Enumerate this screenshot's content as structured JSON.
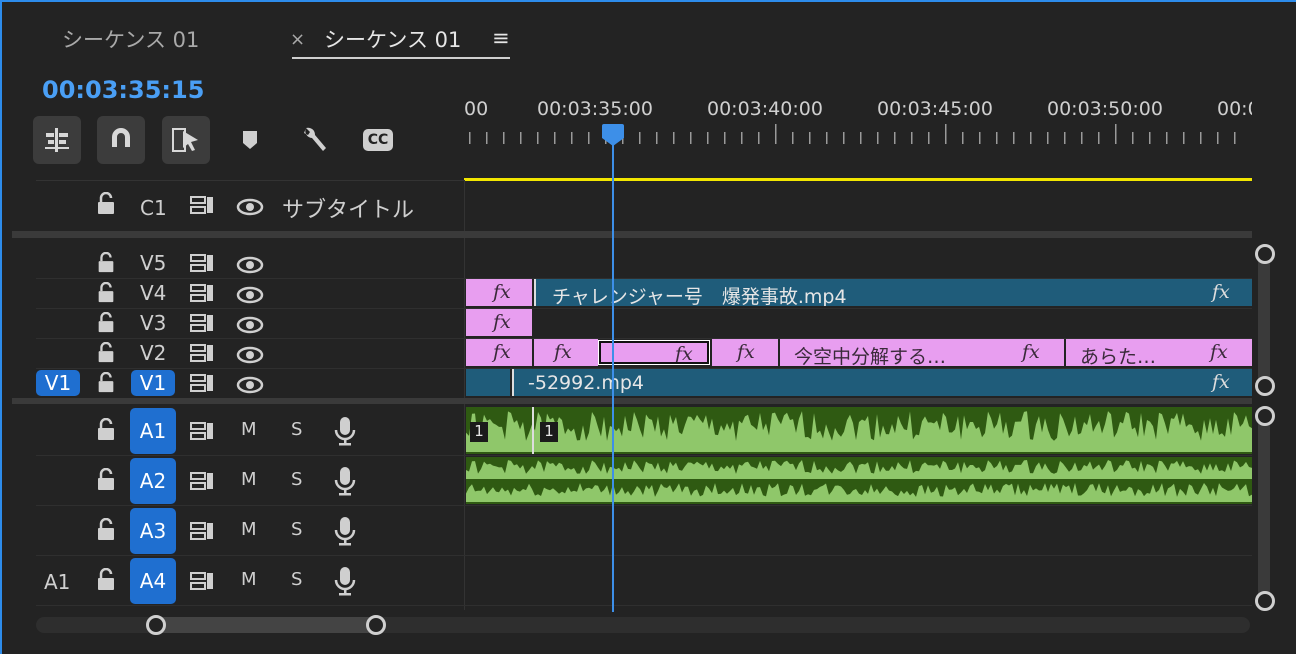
{
  "tabs": [
    {
      "label": "シーケンス 01",
      "active": false
    },
    {
      "label": "シーケンス 01",
      "active": true
    }
  ],
  "tab_close": "×",
  "tab_menu": "≡",
  "timecode": "00:03:35:15",
  "ruler": {
    "labels": [
      "00",
      "00:03:35:00",
      "00:03:40:00",
      "00:03:45:00",
      "00:03:50:00",
      "00:0"
    ]
  },
  "tools": {
    "cc_label": "CC"
  },
  "caption_track": {
    "name": "C1",
    "title": "サブタイトル"
  },
  "video_tracks": [
    {
      "name": "V5"
    },
    {
      "name": "V4"
    },
    {
      "name": "V3"
    },
    {
      "name": "V2"
    },
    {
      "name": "V1",
      "source": "V1"
    }
  ],
  "audio_tracks": [
    {
      "name": "A1",
      "source": ""
    },
    {
      "name": "A2",
      "source": ""
    },
    {
      "name": "A3",
      "source": ""
    },
    {
      "name": "A4",
      "source": "A1"
    }
  ],
  "audio_buttons": {
    "mute": "M",
    "solo": "S"
  },
  "clips": {
    "v4_name": "チャレンジャー号　爆発事故.mp4",
    "v2_text1": "今空中分解する…",
    "v2_text2": "あらた…",
    "v1_name": "-52992.mp4",
    "fx": "fx",
    "a1_marker": "1"
  },
  "colors": {
    "accent": "#2d8ceb",
    "video_clip": "#1f5c7a",
    "graphic_clip": "#e89ef0",
    "audio_clip": "#2f5a12",
    "work_area": "#f2e600"
  }
}
